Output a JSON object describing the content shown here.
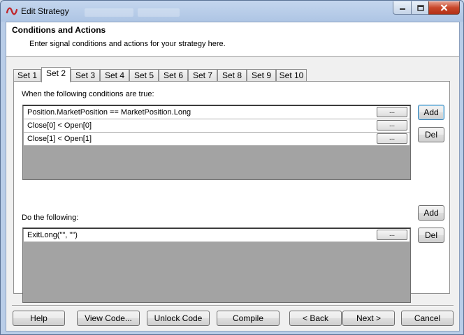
{
  "window": {
    "title": "Edit Strategy"
  },
  "header": {
    "title": "Conditions and Actions",
    "subtitle": "Enter signal conditions and actions for your strategy here."
  },
  "tabs": [
    {
      "label": "Set 1"
    },
    {
      "label": "Set 2"
    },
    {
      "label": "Set 3"
    },
    {
      "label": "Set 4"
    },
    {
      "label": "Set 5"
    },
    {
      "label": "Set 6"
    },
    {
      "label": "Set 7"
    },
    {
      "label": "Set 8"
    },
    {
      "label": "Set 9"
    },
    {
      "label": "Set 10"
    }
  ],
  "active_tab": "Set 2",
  "conditions": {
    "label": "When the following conditions are true:",
    "rows": [
      "Position.MarketPosition == MarketPosition.Long",
      "Close[0] < Open[0]",
      "Close[1] < Open[1]"
    ],
    "row_button": "...",
    "add": "Add",
    "del": "Del"
  },
  "actions": {
    "label": "Do the following:",
    "rows": [
      "ExitLong(\"\", \"\")"
    ],
    "row_button": "...",
    "add": "Add",
    "del": "Del"
  },
  "footer": {
    "help": "Help",
    "view_code": "View Code...",
    "unlock_code": "Unlock Code",
    "compile": "Compile",
    "back": "< Back",
    "next": "Next >",
    "cancel": "Cancel"
  }
}
